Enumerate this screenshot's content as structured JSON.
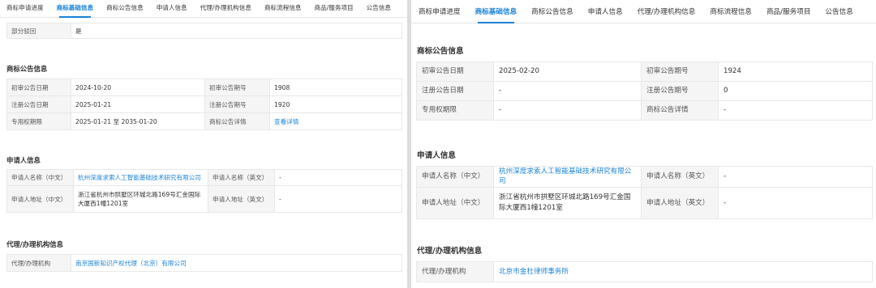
{
  "tabs": [
    "商标申请进度",
    "商标基础信息",
    "商标公告信息",
    "申请人信息",
    "代理/办理机构信息",
    "商标流程信息",
    "商品/服务项目",
    "公告信息"
  ],
  "active_tab": "商标基础信息",
  "colors": {
    "link": "#1a83d6",
    "label_bg": "#f5f5f5",
    "border": "#e8e8e8"
  },
  "left": {
    "partial_reject": {
      "label": "部分驳回",
      "value": "是"
    },
    "announcement": {
      "title": "商标公告信息",
      "prelim_date_label": "初审公告日期",
      "prelim_date": "2024-10-20",
      "prelim_issue_label": "初审公告期号",
      "prelim_issue": "1908",
      "reg_date_label": "注册公告日期",
      "reg_date": "2025-01-21",
      "reg_issue_label": "注册公告期号",
      "reg_issue": "1920",
      "term_label": "专用权期限",
      "term": "2025-01-21  至 2035-01-20",
      "detail_label": "商标公告详情",
      "detail_link": "查看详情"
    },
    "applicant": {
      "title": "申请人信息",
      "name_cn_label": "申请人名称（中文）",
      "name_cn": "杭州深度求索人工智能基础技术研究有限公司",
      "name_en_label": "申请人名称（英文）",
      "name_en": "-",
      "addr_cn_label": "申请人地址（中文）",
      "addr_cn": "浙江省杭州市拱墅区环城北路169号汇金国际大厦西1幢1201室",
      "addr_en_label": "申请人地址（英文）",
      "addr_en": "-"
    },
    "agency": {
      "title": "代理/办理机构信息",
      "label": "代理/办理机构",
      "value": "南京国新知识产权代理（北京）有限公司"
    }
  },
  "right": {
    "announcement": {
      "title": "商标公告信息",
      "prelim_date_label": "初审公告日期",
      "prelim_date": "2025-02-20",
      "prelim_issue_label": "初审公告期号",
      "prelim_issue": "1924",
      "reg_date_label": "注册公告日期",
      "reg_date": "-",
      "reg_issue_label": "注册公告期号",
      "reg_issue": "0",
      "term_label": "专用权期限",
      "term": "-",
      "detail_label": "商标公告详情",
      "detail": "-"
    },
    "applicant": {
      "title": "申请人信息",
      "name_cn_label": "申请人名称（中文）",
      "name_cn": "杭州深度求索人工智能基础技术研究有限公司",
      "name_en_label": "申请人名称（英文）",
      "name_en": "-",
      "addr_cn_label": "申请人地址（中文）",
      "addr_cn": "浙江省杭州市拱墅区环城北路169号汇金国际大厦西1幢1201室",
      "addr_en_label": "申请人地址（英文）",
      "addr_en": "-"
    },
    "agency": {
      "title": "代理/办理机构信息",
      "label": "代理/办理机构",
      "value": "北京市金杜律师事务所"
    }
  }
}
